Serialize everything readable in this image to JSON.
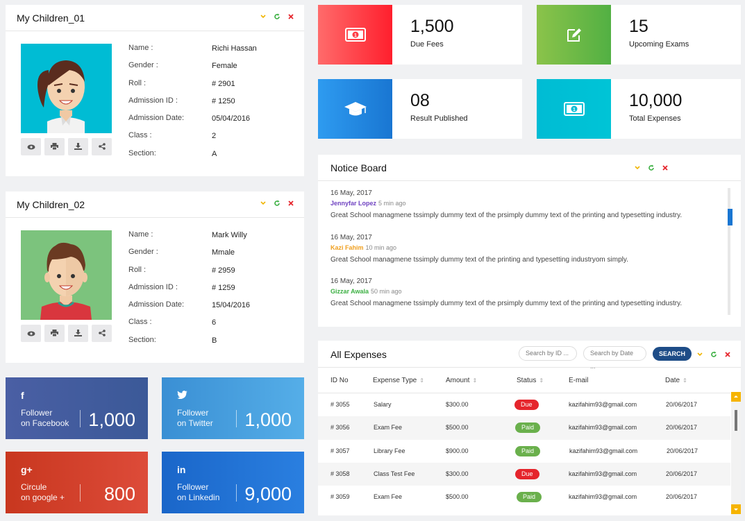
{
  "children": [
    {
      "title": "My Children_01",
      "labels": [
        "Name :",
        "Gender :",
        "Roll :",
        "Admission ID :",
        "Admission Date:",
        "Class :",
        "Section:"
      ],
      "values": [
        "Richi Hassan",
        "Female",
        "# 2901",
        "# 1250",
        "05/04/2016",
        "2",
        "A"
      ],
      "avatar_bg": "#00bcd4"
    },
    {
      "title": "My Children_02",
      "labels": [
        "Name :",
        "Gender :",
        "Roll :",
        "Admission ID :",
        "Admission Date:",
        "Class :",
        "Section:"
      ],
      "values": [
        "Mark Willy",
        "Mmale",
        "# 2959",
        "# 1259",
        "15/04/2016",
        "6",
        "B"
      ],
      "avatar_bg": "#7cc37d"
    }
  ],
  "stats": [
    {
      "value": "1,500",
      "label": "Due Fees",
      "icon": "money-icon",
      "color": "#ff2e3a"
    },
    {
      "value": "15",
      "label": "Upcoming Exams",
      "icon": "edit-icon",
      "color": "#66bb3a"
    },
    {
      "value": "08",
      "label": "Result Published",
      "icon": "graduation-cap-icon",
      "color": "#1e88e5"
    },
    {
      "value": "10,000",
      "label": "Total Expenses",
      "icon": "money-icon",
      "color": "#00bcd4"
    }
  ],
  "social": [
    {
      "icon_text": "f",
      "line1": "Follower",
      "line2": "on Facebook",
      "value": "1,000",
      "color": "#3b5998"
    },
    {
      "icon_text": "t",
      "line1": "Follower",
      "line2": "on Twitter",
      "value": "1,000",
      "color": "#2f92d8"
    },
    {
      "icon_text": "g+",
      "line1": "Circule",
      "line2": "on google +",
      "value": "800",
      "color": "#d23c28"
    },
    {
      "icon_text": "in",
      "line1": "Follower",
      "line2": "on Linkedin",
      "value": "9,000",
      "color": "#1f6fd1"
    }
  ],
  "notice": {
    "title": "Notice Board",
    "items": [
      {
        "date": "16 May, 2017",
        "author": "Jennyfar Lopez",
        "author_color": "#6f42c1",
        "ago": "5 min ago",
        "text": "Great School managmene tssimply dummy text of the prsimply dummy text of the printing and typesetting industry."
      },
      {
        "date": "16 May, 2017",
        "author": "Kazi Fahim",
        "author_color": "#f0a020",
        "ago": "10 min ago",
        "text": "Great School managmene tssimply dummy text of the printing and typesetting industryom simply."
      },
      {
        "date": "16 May, 2017",
        "author": "Gizzar Awala",
        "author_color": "#3cb043",
        "ago": "50 min ago",
        "text": "Great School managmene tssimply dummy text of the prsimply dummy text of the printing and typesetting industry."
      }
    ]
  },
  "expenses": {
    "title": "All Expenses",
    "search_id": "Search by ID ...",
    "search_date": "Search by Date ...",
    "search_label": "SEARCH",
    "headers": [
      "ID No",
      "Expense Type",
      "Amount",
      "Status",
      "E-mail",
      "Date"
    ],
    "rows": [
      {
        "id": "# 3055",
        "type": "Salary",
        "amount": "$300.00",
        "status": "Due",
        "email": "kazifahim93@gmail.com",
        "date": "20/06/2017"
      },
      {
        "id": "# 3056",
        "type": "Exam Fee",
        "amount": "$500.00",
        "status": "Paid",
        "email": "kazifahim93@gmail.com",
        "date": "20/06/2017"
      },
      {
        "id": "# 3057",
        "type": "Library Fee",
        "amount": "$900.00",
        "status": "Paid",
        "email": "kazifahim93@gmail.com",
        "date": "20/06/2017"
      },
      {
        "id": "# 3058",
        "type": "Class Test Fee",
        "amount": "$300.00",
        "status": "Due",
        "email": "kazifahim93@gmail.com",
        "date": "20/06/2017"
      },
      {
        "id": "# 3059",
        "type": "Exam Fee",
        "amount": "$500.00",
        "status": "Paid",
        "email": "kazifahim93@gmail.com",
        "date": "20/06/2017"
      }
    ]
  },
  "colors": {
    "due": "#e5252c",
    "paid": "#6ab04c",
    "minimize": "#f0b400",
    "refresh": "#3cb043",
    "close": "#e5252c"
  }
}
